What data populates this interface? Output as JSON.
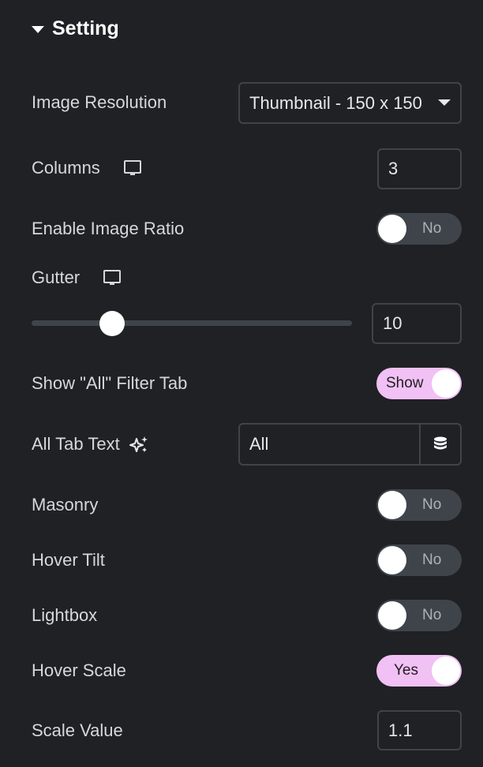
{
  "section": {
    "title": "Setting",
    "expanded": true
  },
  "image_resolution": {
    "label": "Image Resolution",
    "value": "Thumbnail - 150 x 150"
  },
  "columns": {
    "label": "Columns",
    "value": "3",
    "device_icon": "desktop-icon"
  },
  "enable_image_ratio": {
    "label": "Enable Image Ratio",
    "state": "No",
    "on": false
  },
  "gutter": {
    "label": "Gutter",
    "value": "10",
    "slider_fraction": 0.25,
    "device_icon": "desktop-icon"
  },
  "show_all_filter_tab": {
    "label": "Show \"All\" Filter Tab",
    "state": "Show",
    "on": true
  },
  "all_tab_text": {
    "label": "All Tab Text",
    "value": "All",
    "ai_icon": "sparkle-icon",
    "dynamic_icon": "database-icon"
  },
  "masonry": {
    "label": "Masonry",
    "state": "No",
    "on": false
  },
  "hover_tilt": {
    "label": "Hover Tilt",
    "state": "No",
    "on": false
  },
  "lightbox": {
    "label": "Lightbox",
    "state": "No",
    "on": false
  },
  "hover_scale": {
    "label": "Hover Scale",
    "state": "Yes",
    "on": true
  },
  "scale_value": {
    "label": "Scale Value",
    "value": "1.1"
  },
  "colors": {
    "background": "#202124",
    "toggle_on": "#f1c0f4",
    "toggle_off": "#3f444b",
    "border": "#3f444b"
  }
}
